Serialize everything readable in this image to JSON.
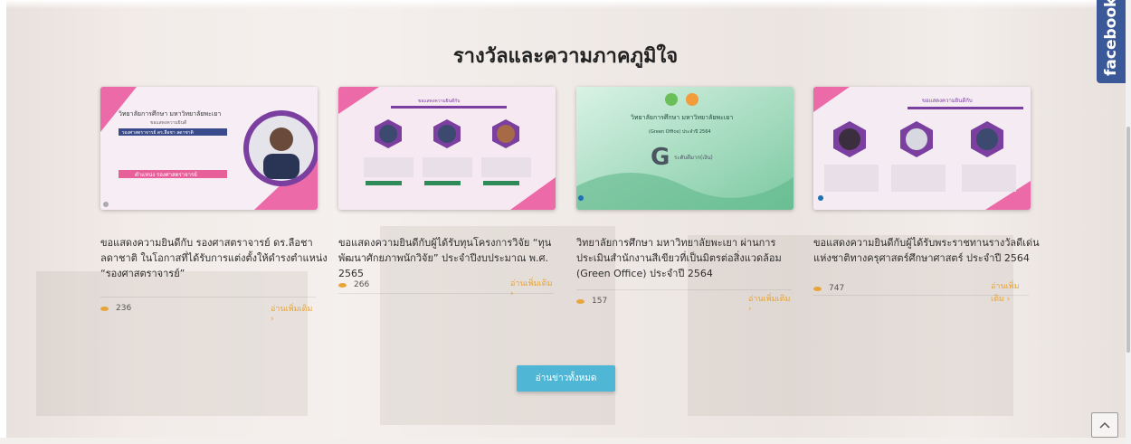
{
  "section": {
    "title": "รางวัลและความภาคภูมิใจ"
  },
  "cards": [
    {
      "caption": "ขอแสดงความยินดีกับ รองศาสตราจารย์ ดร.ลือชา ลดาชาติ ในโอกาสที่ได้รับการแต่งตั้งให้ดำรงตำแหน่ง “รองศาสตราจารย์”",
      "views": "236",
      "more": "อ่านเพิ่มเติม",
      "thumb_texts": [
        "วิทยาลัยการศึกษา มหาวิทยาลัยพะเยา",
        "ขอแสดงความยินดี",
        "รองศาสตราจารย์ ดร.ลือชา ลดาชาติ",
        "ตำแหน่ง รองศาสตราจารย์"
      ]
    },
    {
      "caption": "ขอแสดงความยินดีกับผู้ได้รับทุนโครงการวิจัย “ทุนพัฒนาศักยภาพนักวิจัย” ประจำปีงบประมาณ พ.ศ. 2565",
      "views": "266",
      "more": "อ่านเพิ่มเติม",
      "thumb_texts": [
        "ขอแสดงความยินดีกับ"
      ]
    },
    {
      "caption": "วิทยาลัยการศึกษา มหาวิทยาลัยพะเยา ผ่านการประเมินสำนักงานสีเขียวที่เป็นมิตรต่อสิ่งแวดล้อม (Green Office) ประจำปี 2564",
      "views": "157",
      "more": "อ่านเพิ่มเติม",
      "thumb_texts": [
        "วิทยาลัยการศึกษา มหาวิทยาลัยพะเยา",
        "(Green Office) ประจำปี 2564",
        "G",
        "ระดับดีมาก(เงิน)"
      ]
    },
    {
      "caption": "ขอแสดงความยินดีกับผู้ได้รับพระราชทานรางวัลดีเด่นแห่งชาติทางครุศาสตร์ศึกษาศาสตร์ ประจำปี 2564",
      "views": "747",
      "more": "อ่านเพิ่มเติม",
      "thumb_texts": [
        "ขอแสดงความยินดีกับ"
      ]
    }
  ],
  "read_all_label": "อ่านข่าวทั้งหมด",
  "facebook_label": "facebook",
  "colors": {
    "accent": "#e8a53b",
    "button": "#4fb6d6",
    "facebook": "#3b5998",
    "pink": "#e4508f"
  },
  "icons": {
    "views": "eye-icon",
    "more": "chevron-right-icon",
    "to_top": "chevron-up-icon"
  }
}
